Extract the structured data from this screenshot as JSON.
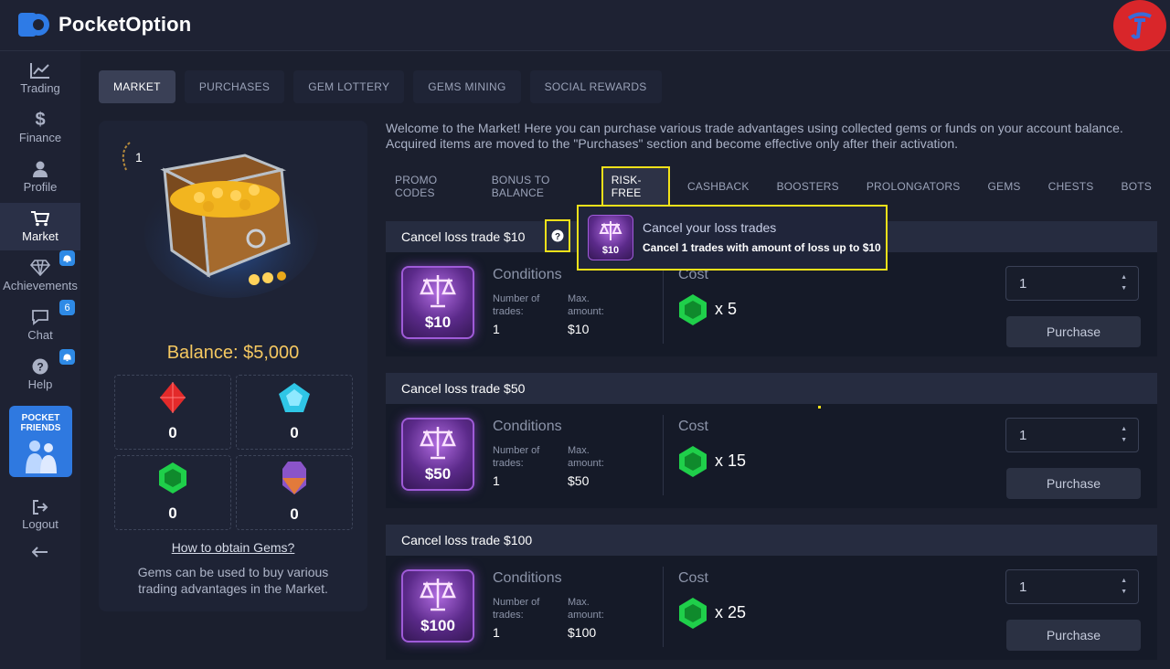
{
  "brand": {
    "name": "PocketOption"
  },
  "nav": {
    "items": [
      {
        "label": "Trading",
        "icon": "chart-line-icon"
      },
      {
        "label": "Finance",
        "icon": "dollar-icon"
      },
      {
        "label": "Profile",
        "icon": "user-icon"
      },
      {
        "label": "Market",
        "icon": "cart-icon"
      },
      {
        "label": "Achievements",
        "icon": "diamond-icon",
        "badge": ""
      },
      {
        "label": "Chat",
        "icon": "chat-icon",
        "badge": "6"
      },
      {
        "label": "Help",
        "icon": "help-icon",
        "badge": ""
      },
      {
        "label": "Logout",
        "icon": "logout-icon"
      }
    ],
    "promo": "POCKET FRIENDS"
  },
  "main_tabs": [
    "MARKET",
    "PURCHASES",
    "GEM LOTTERY",
    "GEMS MINING",
    "SOCIAL REWARDS"
  ],
  "chest": {
    "level": "1",
    "balance": "Balance: $5,000",
    "gems": [
      {
        "name": "red-gem",
        "count": "0",
        "color": "#e32a2a"
      },
      {
        "name": "blue-gem",
        "count": "0",
        "color": "#2fc6e6"
      },
      {
        "name": "green-gem",
        "count": "0",
        "color": "#1fcf4a"
      },
      {
        "name": "purple-gem",
        "count": "0",
        "color": "#8a54c9"
      }
    ],
    "howto": "How to obtain Gems?",
    "desc": "Gems can be used to buy various trading advantages in the Market."
  },
  "welcome": "Welcome to the Market! Here you can purchase various trade advantages using collected gems or funds on your account balance. Acquired items are moved to the \"Purchases\" section and become effective only after their activation.",
  "sub_tabs": [
    "PROMO CODES",
    "BONUS TO BALANCE",
    "RISK-FREE",
    "CASHBACK",
    "BOOSTERS",
    "PROLONGATORS",
    "GEMS",
    "CHESTS",
    "BOTS"
  ],
  "tooltip": {
    "title": "Cancel your loss trades",
    "subtitle": "Cancel 1 trades with amount of loss up to $10",
    "price": "$10"
  },
  "cards": [
    {
      "title": "Cancel loss trade $10",
      "price": "$10",
      "conditions": "Conditions",
      "trades_label": "Number of trades:",
      "trades": "1",
      "amount_label": "Max. amount:",
      "amount": "$10",
      "cost_label": "Cost",
      "cost": "x 5",
      "qty": "1",
      "button": "Purchase"
    },
    {
      "title": "Cancel loss trade $50",
      "price": "$50",
      "conditions": "Conditions",
      "trades_label": "Number of trades:",
      "trades": "1",
      "amount_label": "Max. amount:",
      "amount": "$50",
      "cost_label": "Cost",
      "cost": "x 15",
      "qty": "1",
      "button": "Purchase"
    },
    {
      "title": "Cancel loss trade $100",
      "price": "$100",
      "conditions": "Conditions",
      "trades_label": "Number of trades:",
      "trades": "1",
      "amount_label": "Max. amount:",
      "amount": "$100",
      "cost_label": "Cost",
      "cost": "x 25",
      "qty": "1",
      "button": "Purchase"
    }
  ],
  "colors": {
    "accent_yellow": "#f1e11a",
    "balance": "#f5c861",
    "active_nav": "#2a3047"
  }
}
